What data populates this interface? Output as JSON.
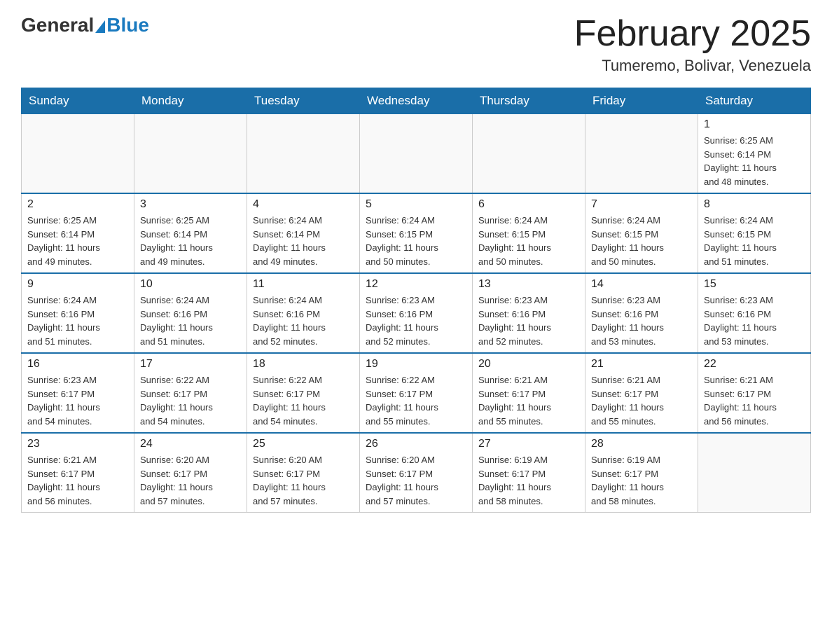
{
  "logo": {
    "general": "General",
    "blue": "Blue"
  },
  "title": "February 2025",
  "location": "Tumeremo, Bolivar, Venezuela",
  "days_of_week": [
    "Sunday",
    "Monday",
    "Tuesday",
    "Wednesday",
    "Thursday",
    "Friday",
    "Saturday"
  ],
  "weeks": [
    [
      {
        "day": "",
        "info": ""
      },
      {
        "day": "",
        "info": ""
      },
      {
        "day": "",
        "info": ""
      },
      {
        "day": "",
        "info": ""
      },
      {
        "day": "",
        "info": ""
      },
      {
        "day": "",
        "info": ""
      },
      {
        "day": "1",
        "info": "Sunrise: 6:25 AM\nSunset: 6:14 PM\nDaylight: 11 hours\nand 48 minutes."
      }
    ],
    [
      {
        "day": "2",
        "info": "Sunrise: 6:25 AM\nSunset: 6:14 PM\nDaylight: 11 hours\nand 49 minutes."
      },
      {
        "day": "3",
        "info": "Sunrise: 6:25 AM\nSunset: 6:14 PM\nDaylight: 11 hours\nand 49 minutes."
      },
      {
        "day": "4",
        "info": "Sunrise: 6:24 AM\nSunset: 6:14 PM\nDaylight: 11 hours\nand 49 minutes."
      },
      {
        "day": "5",
        "info": "Sunrise: 6:24 AM\nSunset: 6:15 PM\nDaylight: 11 hours\nand 50 minutes."
      },
      {
        "day": "6",
        "info": "Sunrise: 6:24 AM\nSunset: 6:15 PM\nDaylight: 11 hours\nand 50 minutes."
      },
      {
        "day": "7",
        "info": "Sunrise: 6:24 AM\nSunset: 6:15 PM\nDaylight: 11 hours\nand 50 minutes."
      },
      {
        "day": "8",
        "info": "Sunrise: 6:24 AM\nSunset: 6:15 PM\nDaylight: 11 hours\nand 51 minutes."
      }
    ],
    [
      {
        "day": "9",
        "info": "Sunrise: 6:24 AM\nSunset: 6:16 PM\nDaylight: 11 hours\nand 51 minutes."
      },
      {
        "day": "10",
        "info": "Sunrise: 6:24 AM\nSunset: 6:16 PM\nDaylight: 11 hours\nand 51 minutes."
      },
      {
        "day": "11",
        "info": "Sunrise: 6:24 AM\nSunset: 6:16 PM\nDaylight: 11 hours\nand 52 minutes."
      },
      {
        "day": "12",
        "info": "Sunrise: 6:23 AM\nSunset: 6:16 PM\nDaylight: 11 hours\nand 52 minutes."
      },
      {
        "day": "13",
        "info": "Sunrise: 6:23 AM\nSunset: 6:16 PM\nDaylight: 11 hours\nand 52 minutes."
      },
      {
        "day": "14",
        "info": "Sunrise: 6:23 AM\nSunset: 6:16 PM\nDaylight: 11 hours\nand 53 minutes."
      },
      {
        "day": "15",
        "info": "Sunrise: 6:23 AM\nSunset: 6:16 PM\nDaylight: 11 hours\nand 53 minutes."
      }
    ],
    [
      {
        "day": "16",
        "info": "Sunrise: 6:23 AM\nSunset: 6:17 PM\nDaylight: 11 hours\nand 54 minutes."
      },
      {
        "day": "17",
        "info": "Sunrise: 6:22 AM\nSunset: 6:17 PM\nDaylight: 11 hours\nand 54 minutes."
      },
      {
        "day": "18",
        "info": "Sunrise: 6:22 AM\nSunset: 6:17 PM\nDaylight: 11 hours\nand 54 minutes."
      },
      {
        "day": "19",
        "info": "Sunrise: 6:22 AM\nSunset: 6:17 PM\nDaylight: 11 hours\nand 55 minutes."
      },
      {
        "day": "20",
        "info": "Sunrise: 6:21 AM\nSunset: 6:17 PM\nDaylight: 11 hours\nand 55 minutes."
      },
      {
        "day": "21",
        "info": "Sunrise: 6:21 AM\nSunset: 6:17 PM\nDaylight: 11 hours\nand 55 minutes."
      },
      {
        "day": "22",
        "info": "Sunrise: 6:21 AM\nSunset: 6:17 PM\nDaylight: 11 hours\nand 56 minutes."
      }
    ],
    [
      {
        "day": "23",
        "info": "Sunrise: 6:21 AM\nSunset: 6:17 PM\nDaylight: 11 hours\nand 56 minutes."
      },
      {
        "day": "24",
        "info": "Sunrise: 6:20 AM\nSunset: 6:17 PM\nDaylight: 11 hours\nand 57 minutes."
      },
      {
        "day": "25",
        "info": "Sunrise: 6:20 AM\nSunset: 6:17 PM\nDaylight: 11 hours\nand 57 minutes."
      },
      {
        "day": "26",
        "info": "Sunrise: 6:20 AM\nSunset: 6:17 PM\nDaylight: 11 hours\nand 57 minutes."
      },
      {
        "day": "27",
        "info": "Sunrise: 6:19 AM\nSunset: 6:17 PM\nDaylight: 11 hours\nand 58 minutes."
      },
      {
        "day": "28",
        "info": "Sunrise: 6:19 AM\nSunset: 6:17 PM\nDaylight: 11 hours\nand 58 minutes."
      },
      {
        "day": "",
        "info": ""
      }
    ]
  ]
}
